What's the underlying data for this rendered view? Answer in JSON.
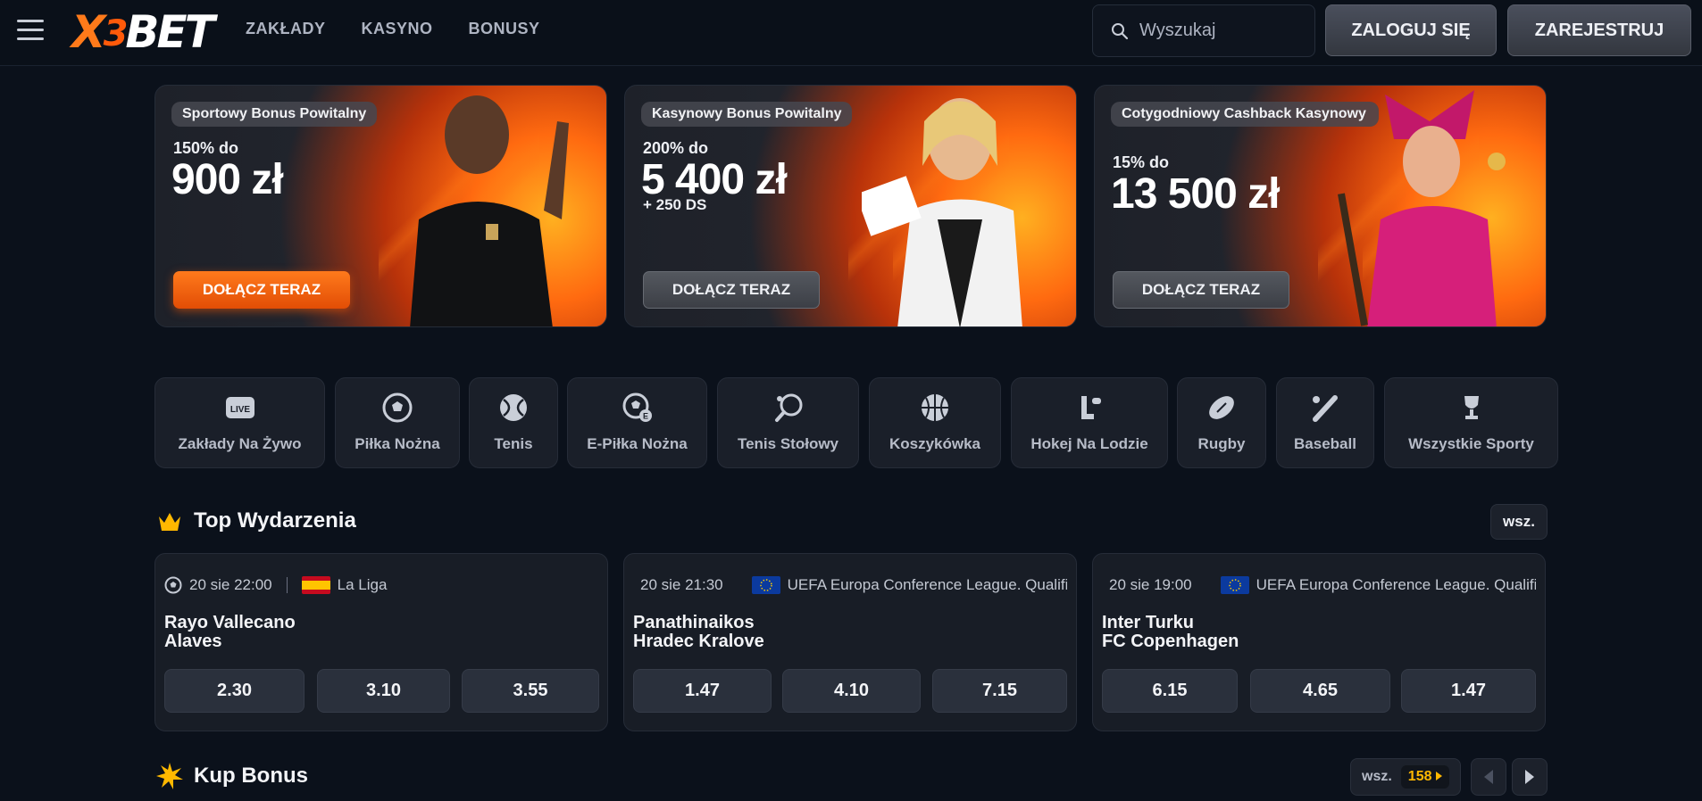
{
  "header": {
    "logo": {
      "x": "X",
      "three": "3",
      "rest": "BET"
    },
    "nav": [
      "ZAKŁADY",
      "KASYNO",
      "BONUSY"
    ],
    "search_placeholder": "Wyszukaj",
    "login": "ZALOGUJ SIĘ",
    "register": "ZAREJESTRUJ"
  },
  "banners": [
    {
      "tag": "Sportowy Bonus Powitalny",
      "pct": "150% do",
      "amount": "900 zł",
      "extra": "",
      "cta": "DOŁĄCZ TERAZ"
    },
    {
      "tag": "Kasynowy Bonus Powitalny",
      "pct": "200% do",
      "amount": "5 400 zł",
      "extra": "+ 250 DS",
      "cta": "DOŁĄCZ TERAZ"
    },
    {
      "tag": "Cotygodniowy Cashback Kasynowy",
      "pct": "15% do",
      "amount": "13 500 zł",
      "extra": "",
      "cta": "DOŁĄCZ TERAZ"
    }
  ],
  "sports": [
    {
      "label": "Zakłady Na Żywo",
      "icon": "live-icon",
      "badge": "LIVE"
    },
    {
      "label": "Piłka Nożna",
      "icon": "football-icon"
    },
    {
      "label": "Tenis",
      "icon": "tennis-icon"
    },
    {
      "label": "E-Piłka Nożna",
      "icon": "efootball-icon"
    },
    {
      "label": "Tenis Stołowy",
      "icon": "table-tennis-icon"
    },
    {
      "label": "Koszykówka",
      "icon": "basketball-icon"
    },
    {
      "label": "Hokej Na Lodzie",
      "icon": "ice-hockey-icon"
    },
    {
      "label": "Rugby",
      "icon": "rugby-icon"
    },
    {
      "label": "Baseball",
      "icon": "baseball-icon"
    },
    {
      "label": "Wszystkie Sporty",
      "icon": "trophy-icon"
    }
  ],
  "top_events": {
    "title": "Top Wydarzenia",
    "all_label": "wsz.",
    "events": [
      {
        "date": "20 sie 22:00",
        "league": "La Liga",
        "flag": "spain",
        "home": "Rayo Vallecano",
        "away": "Alaves",
        "odds": [
          "2.30",
          "3.10",
          "3.55"
        ]
      },
      {
        "date": "20 sie 21:30",
        "league": "UEFA Europa Conference League. Qualification",
        "flag": "eu",
        "home": "Panathinaikos",
        "away": "Hradec Kralove",
        "odds": [
          "1.47",
          "4.10",
          "7.15"
        ]
      },
      {
        "date": "20 sie 19:00",
        "league": "UEFA Europa Conference League. Qualification",
        "flag": "eu",
        "home": "Inter Turku",
        "away": "FC Copenhagen",
        "odds": [
          "6.15",
          "4.65",
          "1.47"
        ]
      }
    ]
  },
  "kup_bonus": {
    "title": "Kup Bonus",
    "all_label": "wsz.",
    "count": "158"
  },
  "colors": {
    "background": "#0b111b",
    "accent_orange": "#ff6a10",
    "count_yellow": "#ffb800"
  }
}
